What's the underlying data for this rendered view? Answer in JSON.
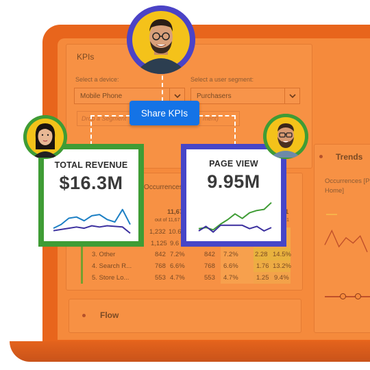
{
  "colors": {
    "laptop_frame": "#e8651c",
    "screen": "#f58a3c",
    "revenue_accent": "#3f9c35",
    "pageview_accent": "#4646c8",
    "share_button": "#1473e6"
  },
  "kpis_panel": {
    "title": "KPIs",
    "device_label": "Select a device:",
    "device_value": "Mobile Phone",
    "segment_label": "Select a user segment:",
    "segment_value": "Purchasers",
    "segment_placeholder_left": "Drop a Segment",
    "segment_placeholder_right": "ment)"
  },
  "share_button": {
    "label": "Share KPIs"
  },
  "revenue_card": {
    "label": "TOTAL REVENUE",
    "value": "$16.3M",
    "series": [
      {
        "name": "",
        "color": "#1c7fc4",
        "values": [
          12,
          18,
          28,
          30,
          24,
          32,
          34,
          26,
          22,
          42,
          18
        ]
      },
      {
        "name": "",
        "color": "#3b2f9e",
        "values": [
          8,
          10,
          12,
          14,
          12,
          16,
          14,
          16,
          15,
          14,
          4
        ]
      }
    ]
  },
  "pageview_card": {
    "label": "PAGE VIEW",
    "value": "9.95M",
    "series": [
      {
        "name": "",
        "color": "#3f9c35",
        "values": [
          10,
          12,
          8,
          18,
          26,
          36,
          28,
          38,
          42,
          44,
          56
        ]
      },
      {
        "name": "",
        "color": "#3b2f9e",
        "values": [
          6,
          14,
          4,
          16,
          16,
          16,
          16,
          10,
          14,
          6,
          12
        ]
      }
    ]
  },
  "table": {
    "occurrences_header": "Occurrences",
    "total_left": "11,67",
    "total_left_sub": "out of 11,67",
    "total_right": "1",
    "total_right_sub": "1",
    "rows": [
      {
        "name": "",
        "a": "1,232",
        "b": "10.6",
        "c": "",
        "d": "",
        "e": "",
        "f": ""
      },
      {
        "name": "",
        "a": "1,125",
        "b": "9.6",
        "c": "",
        "d": "",
        "e": "",
        "f": ""
      },
      {
        "name": "3. Other",
        "a": "842",
        "b": "7.2%",
        "c": "842",
        "d": "7.2%",
        "e": "2.28",
        "f": "14.5%"
      },
      {
        "name": "4. Search R...",
        "a": "768",
        "b": "6.6%",
        "c": "768",
        "d": "6.6%",
        "e": "1.76",
        "f": "13.2%"
      },
      {
        "name": "5. Store Lo...",
        "a": "553",
        "b": "4.7%",
        "c": "553",
        "d": "4.7%",
        "e": "1.25",
        "f": "9.4%"
      }
    ]
  },
  "trends_panel": {
    "title": "Trends",
    "subtitle": "Occurrences [P Home]",
    "values": [
      22,
      38,
      20,
      30,
      24,
      32,
      14
    ]
  },
  "flow_panel": {
    "title": "Flow"
  },
  "avatars": {
    "top": "avatar-man-glasses",
    "left": "avatar-woman",
    "right": "avatar-man-beard"
  }
}
